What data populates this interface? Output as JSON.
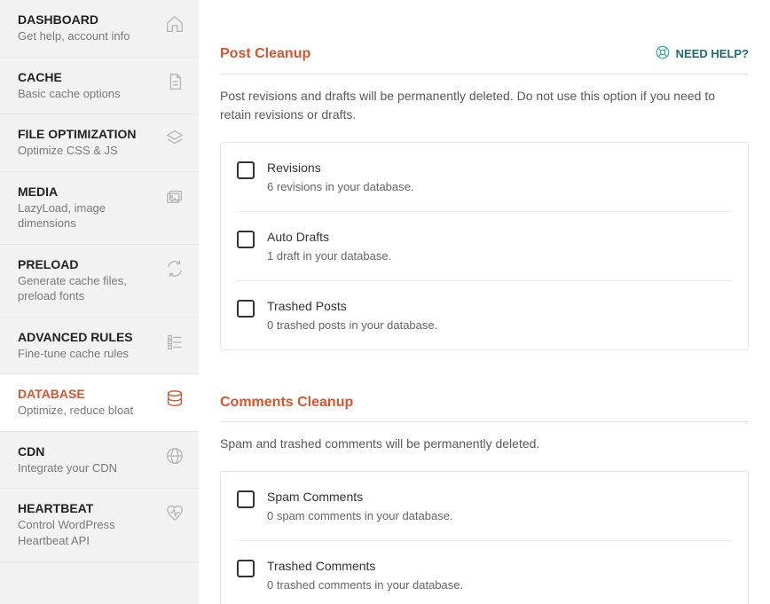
{
  "sidebar": {
    "items": [
      {
        "title": "DASHBOARD",
        "sub": "Get help, account info",
        "icon": "home"
      },
      {
        "title": "CACHE",
        "sub": "Basic cache options",
        "icon": "file"
      },
      {
        "title": "FILE OPTIMIZATION",
        "sub": "Optimize CSS & JS",
        "icon": "layers"
      },
      {
        "title": "MEDIA",
        "sub": "LazyLoad, image dimensions",
        "icon": "images"
      },
      {
        "title": "PRELOAD",
        "sub": "Generate cache files, preload fonts",
        "icon": "refresh"
      },
      {
        "title": "ADVANCED RULES",
        "sub": "Fine-tune cache rules",
        "icon": "sliders"
      },
      {
        "title": "DATABASE",
        "sub": "Optimize, reduce bloat",
        "icon": "database",
        "active": true
      },
      {
        "title": "CDN",
        "sub": "Integrate your CDN",
        "icon": "globe"
      },
      {
        "title": "HEARTBEAT",
        "sub": "Control WordPress Heartbeat API",
        "icon": "heartbeat"
      }
    ]
  },
  "help_label": "NEED HELP?",
  "sections": [
    {
      "title": "Post Cleanup",
      "desc": "Post revisions and drafts will be permanently deleted. Do not use this option if you need to retain revisions or drafts.",
      "show_help": true,
      "items": [
        {
          "label": "Revisions",
          "detail": "6 revisions in your database."
        },
        {
          "label": "Auto Drafts",
          "detail": "1 draft in your database."
        },
        {
          "label": "Trashed Posts",
          "detail": "0 trashed posts in your database."
        }
      ]
    },
    {
      "title": "Comments Cleanup",
      "desc": "Spam and trashed comments will be permanently deleted.",
      "show_help": false,
      "items": [
        {
          "label": "Spam Comments",
          "detail": "0 spam comments in your database."
        },
        {
          "label": "Trashed Comments",
          "detail": "0 trashed comments in your database."
        }
      ]
    }
  ]
}
